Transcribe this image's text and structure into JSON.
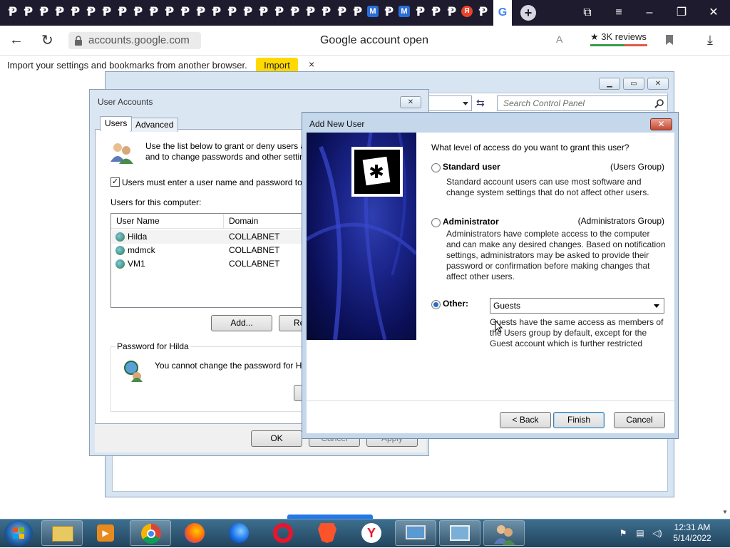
{
  "browser": {
    "pinned_tab_glyph": "Ᵽ",
    "m_tab_glyph": "M",
    "y_tab_glyph": "Я",
    "g_tab_glyph": "G",
    "new_tab_glyph": "+",
    "url": "accounts.google.com",
    "page_title": "Google account open",
    "reviews": "★ 3K reviews",
    "info_text": "Import your settings and bookmarks from another browser.",
    "import_label": "Import",
    "info_close": "×"
  },
  "control_panel": {
    "search_placeholder": "Search Control Panel"
  },
  "user_accounts": {
    "title": "User Accounts",
    "close_glyph": "✕",
    "tabs": [
      {
        "label": "Users"
      },
      {
        "label": "Advanced"
      }
    ],
    "intro_line1": "Use the list below to grant or deny users a",
    "intro_line2": "and to change passwords and other settin",
    "must_enter_label": "Users must enter a user name and password to u",
    "users_label": "Users for this computer:",
    "columns": [
      "User Name",
      "Domain"
    ],
    "users": [
      {
        "name": "Hilda",
        "domain": "COLLABNET"
      },
      {
        "name": "mdmck",
        "domain": "COLLABNET"
      },
      {
        "name": "VM1",
        "domain": "COLLABNET"
      }
    ],
    "add_label": "Add...",
    "remove_label": "Re",
    "password_group": "Password for Hilda",
    "password_text": "You cannot change the password for H",
    "ok_label": "OK",
    "cancel_label": "Cancel",
    "apply_label": "Apply"
  },
  "add_user": {
    "title": "Add New User",
    "close_glyph": "✕",
    "question": "What level of access do you want to grant this user?",
    "options": [
      {
        "label": "Standard user",
        "group": "(Users Group)",
        "desc_lines": [
          "Standard account users can use most software and",
          "change system settings that do not affect other users."
        ],
        "selected": false
      },
      {
        "label": "Administrator",
        "group": "(Administrators Group)",
        "desc_lines": [
          "Administrators have complete access to the computer",
          "and can make any desired changes. Based on notification",
          "settings, administrators may be asked to provide their",
          "password or confirmation before making changes that",
          "affect other users."
        ],
        "selected": false
      },
      {
        "label": "Other:",
        "selected": true
      }
    ],
    "other_value": "Guests",
    "other_desc_lines": [
      "Guests have the same access as members of",
      "the Users group by default, except for the",
      "Guest account which is further restricted"
    ],
    "back_label": "< Back",
    "finish_label": "Finish",
    "cancel_label": "Cancel"
  },
  "taskbar": {
    "time": "12:31 AM",
    "date": "5/14/2022"
  }
}
